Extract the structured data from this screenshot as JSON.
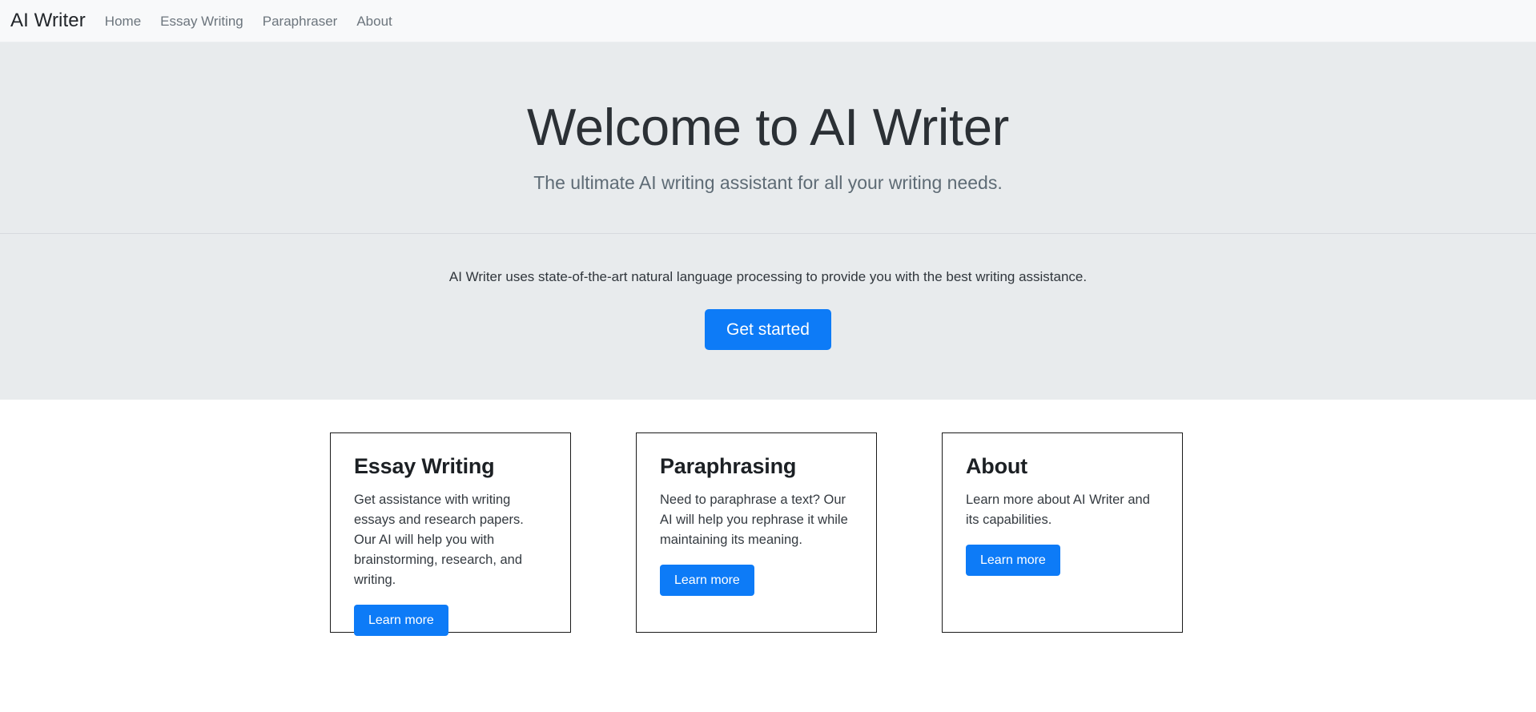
{
  "navbar": {
    "brand": "AI Writer",
    "links": [
      {
        "label": "Home"
      },
      {
        "label": "Essay Writing"
      },
      {
        "label": "Paraphraser"
      },
      {
        "label": "About"
      }
    ]
  },
  "hero": {
    "title": "Welcome to AI Writer",
    "subtitle": "The ultimate AI writing assistant for all your writing needs.",
    "description": "AI Writer uses state-of-the-art natural language processing to provide you with the best writing assistance.",
    "cta_label": "Get started"
  },
  "cards": [
    {
      "title": "Essay Writing",
      "text": "Get assistance with writing essays and research papers. Our AI will help you with brainstorming, research, and writing.",
      "button_label": "Learn more"
    },
    {
      "title": "Paraphrasing",
      "text": "Need to paraphrase a text? Our AI will help you rephrase it while maintaining its meaning.",
      "button_label": "Learn more"
    },
    {
      "title": "About",
      "text": "Learn more about AI Writer and its capabilities.",
      "button_label": "Learn more"
    }
  ],
  "colors": {
    "accent": "#0d7bf7",
    "navbar_bg": "#f8f9fa",
    "hero_bg": "#e8ebed",
    "nav_link": "#6c757d",
    "card_border": "#1a1a1a",
    "page_bg": "#ffffff"
  }
}
